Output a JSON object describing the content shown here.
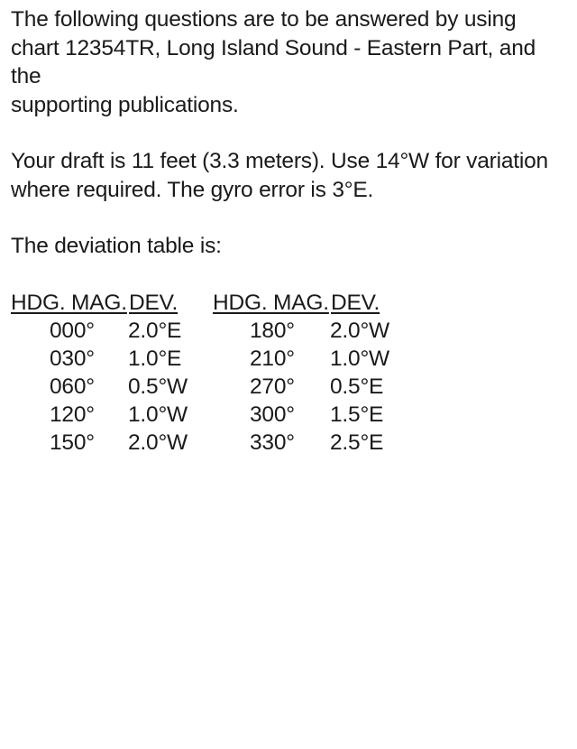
{
  "intro": {
    "line1": "The following questions are to be answered by using",
    "line2": "chart 12354TR, Long Island Sound - Eastern Part, and the",
    "line3": "supporting publications."
  },
  "conditions": {
    "line1": "Your draft is 11 feet (3.3 meters). Use 14°W for variation",
    "line2": "where required. The gyro error is 3°E."
  },
  "table_intro": "The deviation table is:",
  "deviation_table": {
    "headers": [
      "HDG. MAG.",
      "DEV.",
      "HDG. MAG.",
      "DEV."
    ],
    "rows": [
      [
        "000°",
        "2.0°E",
        "180°",
        "2.0°W"
      ],
      [
        "030°",
        "1.0°E",
        "210°",
        "1.0°W"
      ],
      [
        "060°",
        "0.5°W",
        "270°",
        "0.5°E"
      ],
      [
        "120°",
        "1.0°W",
        "300°",
        "1.5°E"
      ],
      [
        "150°",
        "2.0°W",
        "330°",
        "2.5°E"
      ]
    ]
  }
}
